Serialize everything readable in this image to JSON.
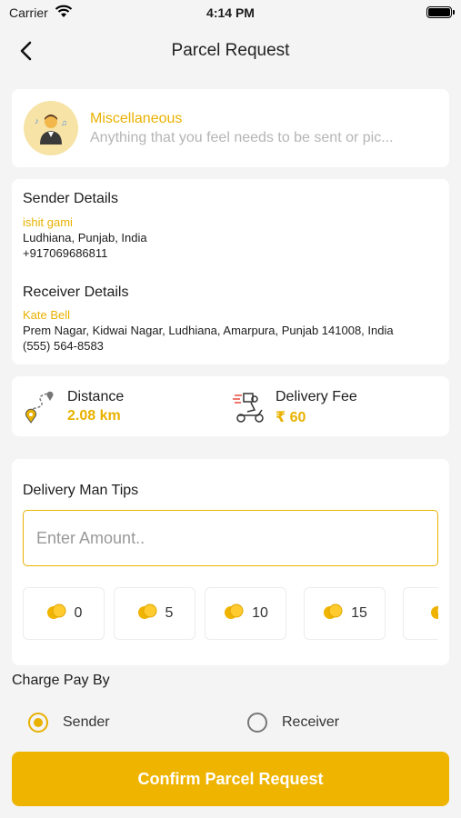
{
  "status_bar": {
    "carrier": "Carrier",
    "time": "4:14 PM"
  },
  "nav": {
    "title": "Parcel Request",
    "back_icon": "chevron-left-icon"
  },
  "category": {
    "name": "Miscellaneous",
    "description": "Anything that you feel needs to be sent or pic...",
    "icon": "person-with-music-notes-icon"
  },
  "sender": {
    "heading": "Sender Details",
    "name": "ishit gami",
    "address": "Ludhiana, Punjab, India",
    "phone": "+917069686811"
  },
  "receiver": {
    "heading": "Receiver Details",
    "name": "Kate Bell",
    "address": "Prem Nagar, Kidwai Nagar, Ludhiana, Amarpura, Punjab 141008, India",
    "phone": "(555) 564-8583"
  },
  "distance": {
    "label": "Distance",
    "value": "2.08 km",
    "icon": "route-pin-icon"
  },
  "delivery_fee": {
    "label": "Delivery Fee",
    "value": "₹ 60",
    "icon": "delivery-scooter-icon"
  },
  "tips": {
    "heading": "Delivery Man Tips",
    "placeholder": "Enter Amount..",
    "chips": [
      "0",
      "5",
      "10",
      "15",
      ""
    ]
  },
  "charge": {
    "heading": "Charge Pay By",
    "options": [
      "Sender",
      "Receiver"
    ],
    "selected": "Sender"
  },
  "confirm_label": "Confirm Parcel Request",
  "colors": {
    "accent": "#efb400",
    "accent_text": "#e9b100",
    "background": "#f4f4f4"
  }
}
